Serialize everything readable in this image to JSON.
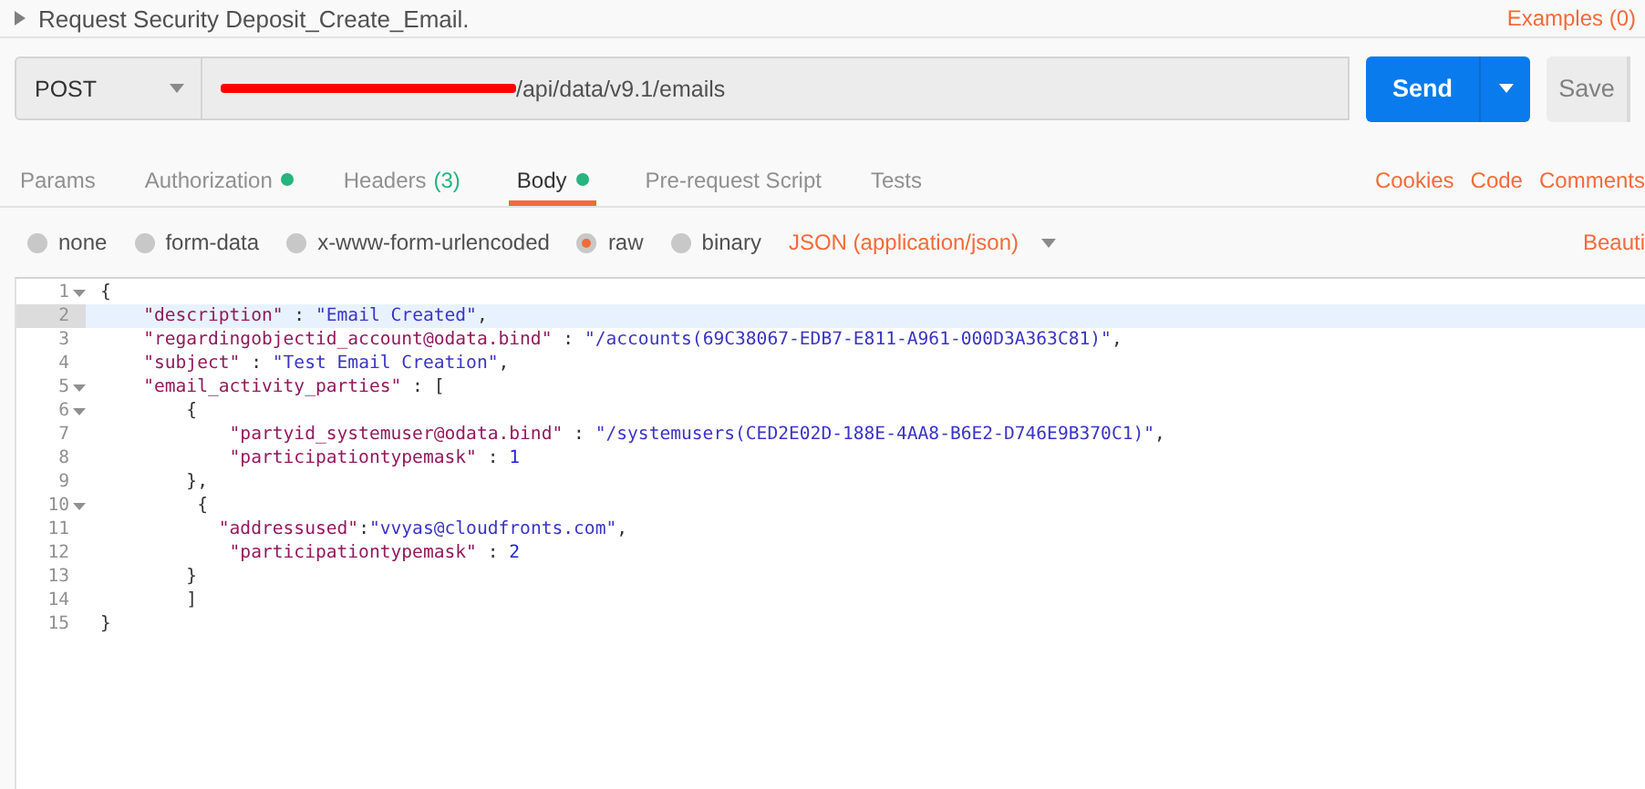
{
  "request": {
    "title": "Request Security Deposit_Create_Email.",
    "examples": "Examples (0)"
  },
  "url_bar": {
    "method": "POST",
    "redacted": true,
    "url": "/api/data/v9.1/emails",
    "send": "Send",
    "save": "Save"
  },
  "tabs": [
    {
      "label": "Params",
      "selected": false,
      "indicator": false
    },
    {
      "label": "Authorization",
      "selected": false,
      "indicator": true
    },
    {
      "label": "Headers",
      "count": "(3)",
      "selected": false,
      "indicator": false
    },
    {
      "label": "Body",
      "selected": true,
      "indicator": true
    },
    {
      "label": "Pre-request Script",
      "selected": false,
      "indicator": false
    },
    {
      "label": "Tests",
      "selected": false,
      "indicator": false
    }
  ],
  "tab_links": [
    "Cookies",
    "Code",
    "Comments"
  ],
  "body_types": [
    {
      "label": "none",
      "selected": false
    },
    {
      "label": "form-data",
      "selected": false
    },
    {
      "label": "x-www-form-urlencoded",
      "selected": false
    },
    {
      "label": "raw",
      "selected": true
    },
    {
      "label": "binary",
      "selected": false
    }
  ],
  "content_type": "JSON (application/json)",
  "beautify": "Beauti",
  "editor": {
    "lines": [
      {
        "number": "1",
        "fold": true,
        "active": false,
        "tokens": [
          {
            "kind": "punct",
            "text": "{"
          }
        ]
      },
      {
        "number": "2",
        "fold": false,
        "active": true,
        "tokens": [
          {
            "kind": "key",
            "text": "    \"description\""
          },
          {
            "kind": "punct",
            "text": " : "
          },
          {
            "kind": "string",
            "text": "\"Email Created\""
          },
          {
            "kind": "punct",
            "text": ","
          }
        ]
      },
      {
        "number": "3",
        "fold": false,
        "active": false,
        "tokens": [
          {
            "kind": "key",
            "text": "    \"regardingobjectid_account@odata.bind\""
          },
          {
            "kind": "punct",
            "text": " : "
          },
          {
            "kind": "string",
            "text": "\"/accounts(69C38067-EDB7-E811-A961-000D3A363C81)\""
          },
          {
            "kind": "punct",
            "text": ","
          }
        ]
      },
      {
        "number": "4",
        "fold": false,
        "active": false,
        "tokens": [
          {
            "kind": "key",
            "text": "    \"subject\""
          },
          {
            "kind": "punct",
            "text": " : "
          },
          {
            "kind": "string",
            "text": "\"Test Email Creation\""
          },
          {
            "kind": "punct",
            "text": ","
          }
        ]
      },
      {
        "number": "5",
        "fold": true,
        "active": false,
        "tokens": [
          {
            "kind": "key",
            "text": "    \"email_activity_parties\""
          },
          {
            "kind": "punct",
            "text": " : ["
          }
        ]
      },
      {
        "number": "6",
        "fold": true,
        "active": false,
        "tokens": [
          {
            "kind": "punct",
            "text": "        {"
          }
        ]
      },
      {
        "number": "7",
        "fold": false,
        "active": false,
        "tokens": [
          {
            "kind": "key",
            "text": "            \"partyid_systemuser@odata.bind\""
          },
          {
            "kind": "punct",
            "text": " : "
          },
          {
            "kind": "string",
            "text": "\"/systemusers(CED2E02D-188E-4AA8-B6E2-D746E9B370C1)\""
          },
          {
            "kind": "punct",
            "text": ","
          }
        ]
      },
      {
        "number": "8",
        "fold": false,
        "active": false,
        "tokens": [
          {
            "kind": "key",
            "text": "            \"participationtypemask\""
          },
          {
            "kind": "punct",
            "text": " : "
          },
          {
            "kind": "number",
            "text": "1"
          }
        ]
      },
      {
        "number": "9",
        "fold": false,
        "active": false,
        "tokens": [
          {
            "kind": "punct",
            "text": "        },"
          }
        ]
      },
      {
        "number": "10",
        "fold": true,
        "active": false,
        "tokens": [
          {
            "kind": "punct",
            "text": "         {"
          }
        ]
      },
      {
        "number": "11",
        "fold": false,
        "active": false,
        "tokens": [
          {
            "kind": "key",
            "text": "           \"addressused\""
          },
          {
            "kind": "punct",
            "text": ":"
          },
          {
            "kind": "string",
            "text": "\"vvyas@cloudfronts.com\""
          },
          {
            "kind": "punct",
            "text": ","
          }
        ]
      },
      {
        "number": "12",
        "fold": false,
        "active": false,
        "tokens": [
          {
            "kind": "key",
            "text": "            \"participationtypemask\""
          },
          {
            "kind": "punct",
            "text": " : "
          },
          {
            "kind": "number",
            "text": "2"
          }
        ]
      },
      {
        "number": "13",
        "fold": false,
        "active": false,
        "tokens": [
          {
            "kind": "punct",
            "text": "        }"
          }
        ]
      },
      {
        "number": "14",
        "fold": false,
        "active": false,
        "tokens": [
          {
            "kind": "punct",
            "text": "        ]"
          }
        ]
      },
      {
        "number": "15",
        "fold": false,
        "active": false,
        "tokens": [
          {
            "kind": "punct",
            "text": "}"
          }
        ]
      }
    ]
  }
}
